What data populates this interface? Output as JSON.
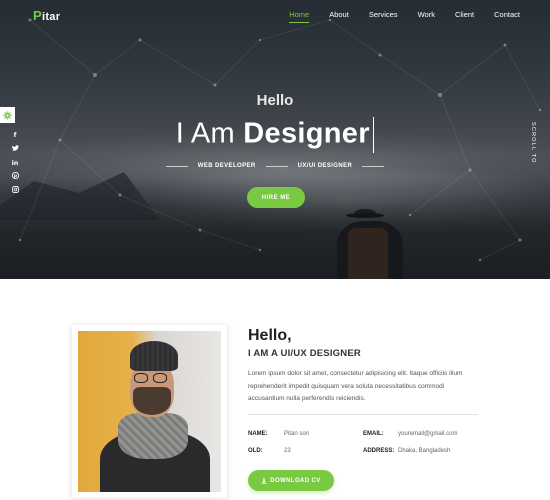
{
  "brand": {
    "logo_first": "P",
    "logo_rest": "itar",
    "accent_color": "#7ac943"
  },
  "nav": {
    "items": [
      {
        "label": "Home",
        "active": true
      },
      {
        "label": "About",
        "active": false
      },
      {
        "label": "Services",
        "active": false
      },
      {
        "label": "Work",
        "active": false
      },
      {
        "label": "Client",
        "active": false
      },
      {
        "label": "Contact",
        "active": false
      }
    ]
  },
  "sidebar": {
    "settings_icon": "gear-icon",
    "social_icons": [
      "facebook-icon",
      "twitter-icon",
      "linkedin-icon",
      "pinterest-icon",
      "instagram-icon"
    ]
  },
  "hero": {
    "greeting": "Hello",
    "title_prefix": "I Am",
    "title_word": "Designer",
    "role_1": "WEB DEVELOPER",
    "role_2": "UX/UI DESIGNER",
    "cta_label": "HIRE ME",
    "scroll_label": "SCROLL TO"
  },
  "about": {
    "greeting": "Hello,",
    "role": "I AM A UI/UX DESIGNER",
    "description": "Lorem ipsum dolor sit amet, consectetur adipisicing elit. Itaque officiis illum reprehenderit impedit quisquam vera soluta necessitatibus commodi accusantium nulla perferendis reiciendis.",
    "info": {
      "name_label": "NAME:",
      "name_value": "Pitan son",
      "email_label": "EMAIL:",
      "email_value": "youremail@gmail.com",
      "old_label": "OLD:",
      "old_value": "23",
      "address_label": "ADDRESS:",
      "address_value": "Dhaka, Bangladesh"
    },
    "download_label": "DOWNLOAD CV"
  }
}
